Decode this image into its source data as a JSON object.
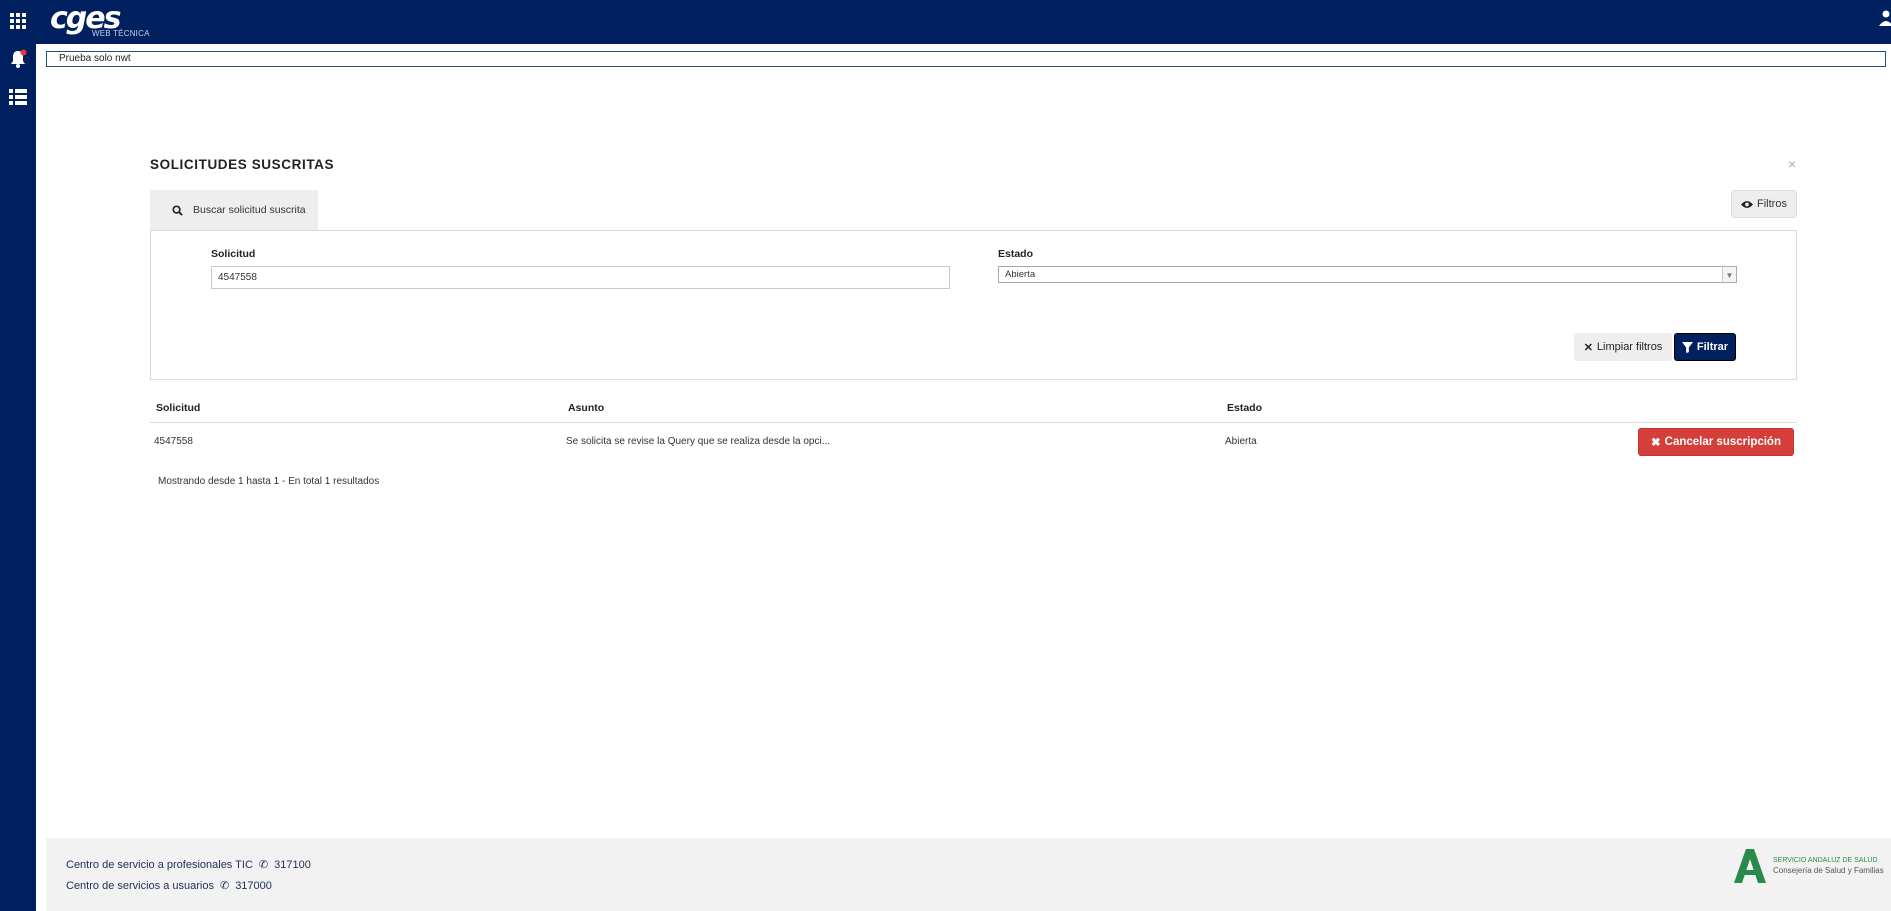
{
  "header": {
    "logo_text": "cges",
    "logo_subtitle": "WEB TÉCNICA",
    "notice": "Prueba solo nwt"
  },
  "panel": {
    "title": "SOLICITUDES SUSCRITAS",
    "close": "×",
    "tab_label": "Buscar solicitud suscrita",
    "filters_button": "Filtros"
  },
  "filters": {
    "solicitud_label": "Solicitud",
    "solicitud_value": "4547558",
    "estado_label": "Estado",
    "estado_value": "Abierta",
    "clear_button": "Limpiar filtros",
    "filter_button": "Filtrar"
  },
  "table": {
    "columns": [
      "Solicitud",
      "Asunto",
      "Estado"
    ],
    "rows": [
      {
        "solicitud": "4547558",
        "asunto": "Se solicita se revise la Query que se realiza desde la opci...",
        "estado": "Abierta",
        "action": "Cancelar suscripción"
      }
    ],
    "summary": "Mostrando desde 1 hasta 1 - En total 1 resultados"
  },
  "footer": {
    "line1_text": "Centro de servicio a profesionales TIC",
    "line1_phone": "317100",
    "line2_text": "Centro de servicios a usuarios",
    "line2_phone": "317000",
    "logo_line1": "SERVICIO ANDALUZ DE SALUD",
    "logo_line2": "Consejería de Salud y Familias"
  },
  "colors": {
    "navy": "#012060",
    "danger": "#d43f3a",
    "notification_dot": "#e53935"
  }
}
